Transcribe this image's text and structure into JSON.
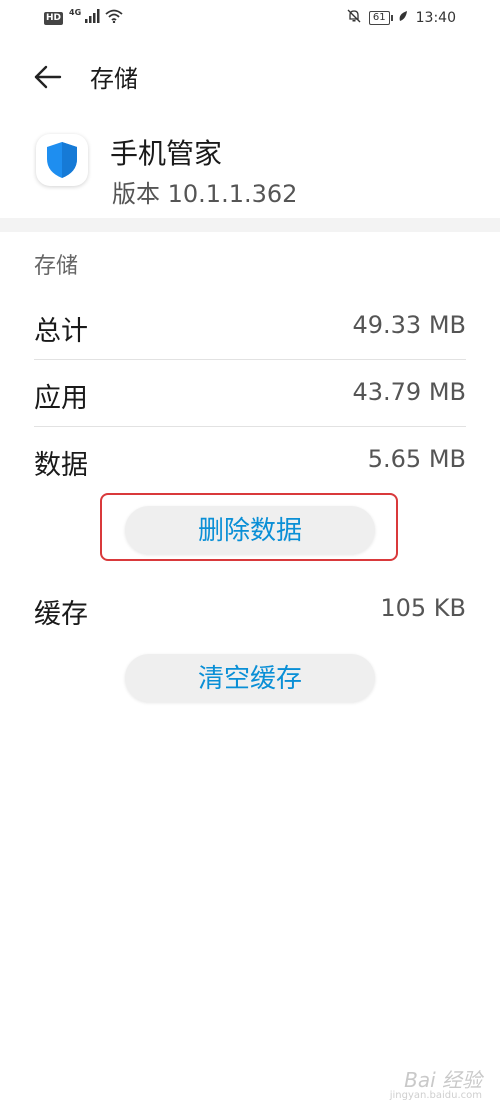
{
  "status_bar": {
    "hd": "HD",
    "network": "4G",
    "battery": "61",
    "time": "13:40"
  },
  "app_bar": {
    "title": "存储"
  },
  "app_info": {
    "name": "手机管家",
    "version": "版本 10.1.1.362"
  },
  "storage": {
    "header": "存储",
    "rows": [
      {
        "label": "总计",
        "value": "49.33 MB"
      },
      {
        "label": "应用",
        "value": "43.79 MB"
      },
      {
        "label": "数据",
        "value": "5.65 MB"
      }
    ],
    "delete_data_label": "删除数据",
    "cache": {
      "label": "缓存",
      "value": "105 KB"
    },
    "clear_cache_label": "清空缓存"
  },
  "watermark": {
    "text": "Bai 经验",
    "sub": "jingyan.baidu.com"
  },
  "colors": {
    "accent": "#0a8fd6",
    "highlight": "#d9393b",
    "shield": "#1e8ef0"
  },
  "icons": [
    "back-arrow-icon",
    "shield-icon",
    "wifi-icon",
    "signal-icon",
    "mute-icon",
    "battery-icon",
    "leaf-icon"
  ]
}
